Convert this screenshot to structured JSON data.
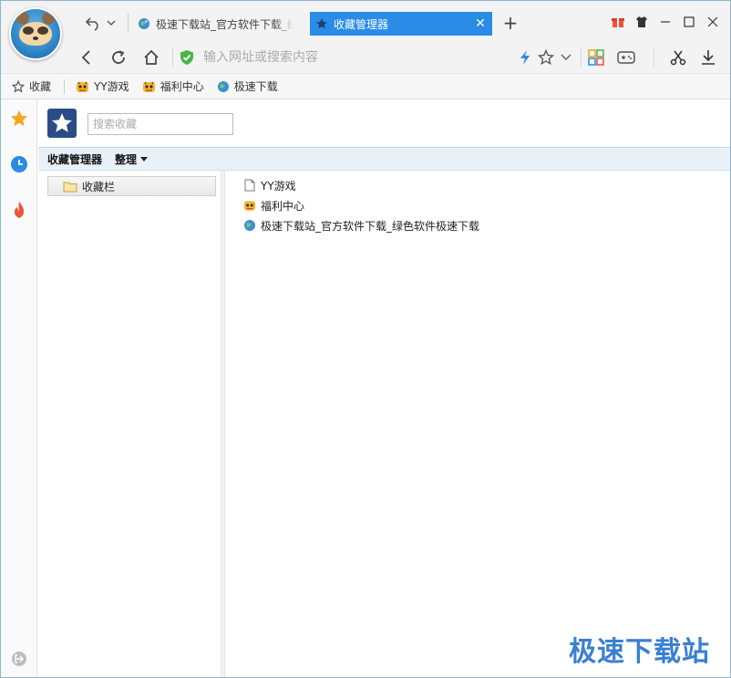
{
  "tabs": [
    {
      "title": "极速下载站_官方软件下载_绿色软件极速下载",
      "active": false
    },
    {
      "title": "收藏管理器",
      "active": true
    }
  ],
  "toolbar": {
    "address_placeholder": "输入网址或搜索内容"
  },
  "bookmarks_bar": {
    "favorites_label": "收藏",
    "items": [
      {
        "label": "YY游戏",
        "icon": "tiger-icon"
      },
      {
        "label": "福利中心",
        "icon": "tiger-icon"
      },
      {
        "label": "极速下载",
        "icon": "globe-icon"
      }
    ]
  },
  "manager": {
    "search_placeholder": "搜索收藏",
    "title": "收藏管理器",
    "organize_label": "整理",
    "folders": [
      {
        "label": "收藏栏"
      }
    ],
    "items": [
      {
        "label": "YY游戏",
        "icon": "page-icon"
      },
      {
        "label": "福利中心",
        "icon": "tiger-icon"
      },
      {
        "label": "极速下载站_官方软件下载_绿色软件极速下载",
        "icon": "globe-icon"
      }
    ]
  },
  "watermark": "极速下载站",
  "colors": {
    "active_tab": "#2a8ce6",
    "star_gold": "#f5a623",
    "history_blue": "#2a8ce6",
    "hot_red": "#f0533a",
    "shield_green": "#4bb34b"
  }
}
